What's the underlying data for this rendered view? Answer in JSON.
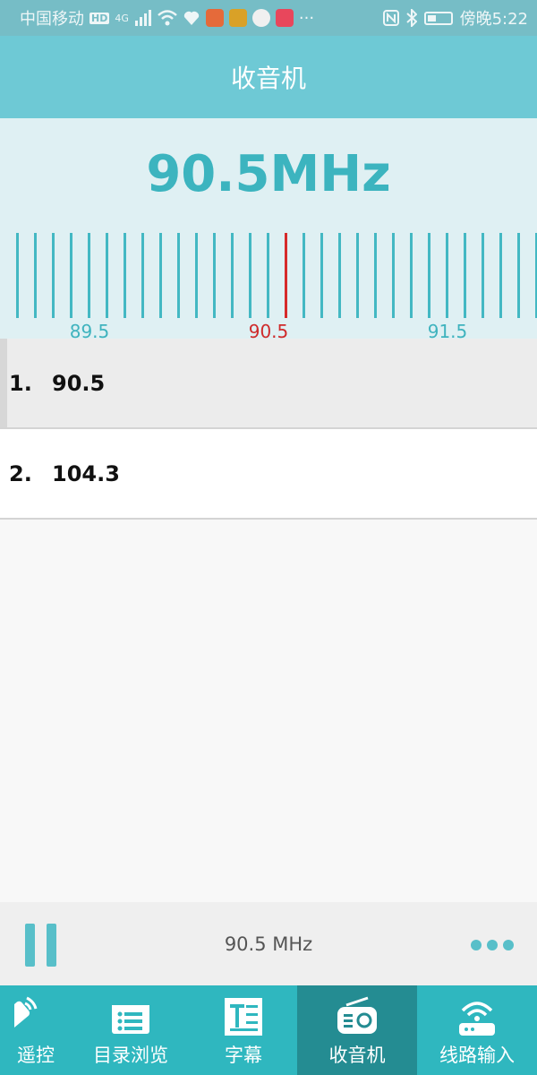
{
  "status_bar": {
    "carrier": "中国移动",
    "network": "4G",
    "time": "傍晚5:22",
    "icons": [
      "hd-icon",
      "signal-icon",
      "wifi-icon",
      "heart-icon",
      "app-icon",
      "app-icon",
      "app-icon",
      "app-icon",
      "nfc-icon",
      "bluetooth-icon",
      "battery-icon"
    ],
    "more": "···"
  },
  "header": {
    "title": "收音机"
  },
  "tuner": {
    "frequency": "90.5MHz",
    "scale_labels": [
      "89.5",
      "90.5",
      "91.5"
    ],
    "active_label": "90.5",
    "accent": "#3cb4bf",
    "active_color": "#d62a2a"
  },
  "stations": [
    {
      "index": "1.",
      "frequency": "90.5",
      "selected": true
    },
    {
      "index": "2.",
      "frequency": "104.3",
      "selected": false
    }
  ],
  "player": {
    "now_playing": "90.5 MHz",
    "play_state": "pause-icon",
    "more_icon": "more-dots-icon"
  },
  "bottom_nav": [
    {
      "label": "遥控",
      "icon": "remote-icon",
      "active": false
    },
    {
      "label": "目录浏览",
      "icon": "list-icon",
      "active": false
    },
    {
      "label": "字幕",
      "icon": "subtitle-icon",
      "active": false
    },
    {
      "label": "收音机",
      "icon": "radio-icon",
      "active": true
    },
    {
      "label": "线路输入",
      "icon": "line-in-icon",
      "active": false
    }
  ]
}
